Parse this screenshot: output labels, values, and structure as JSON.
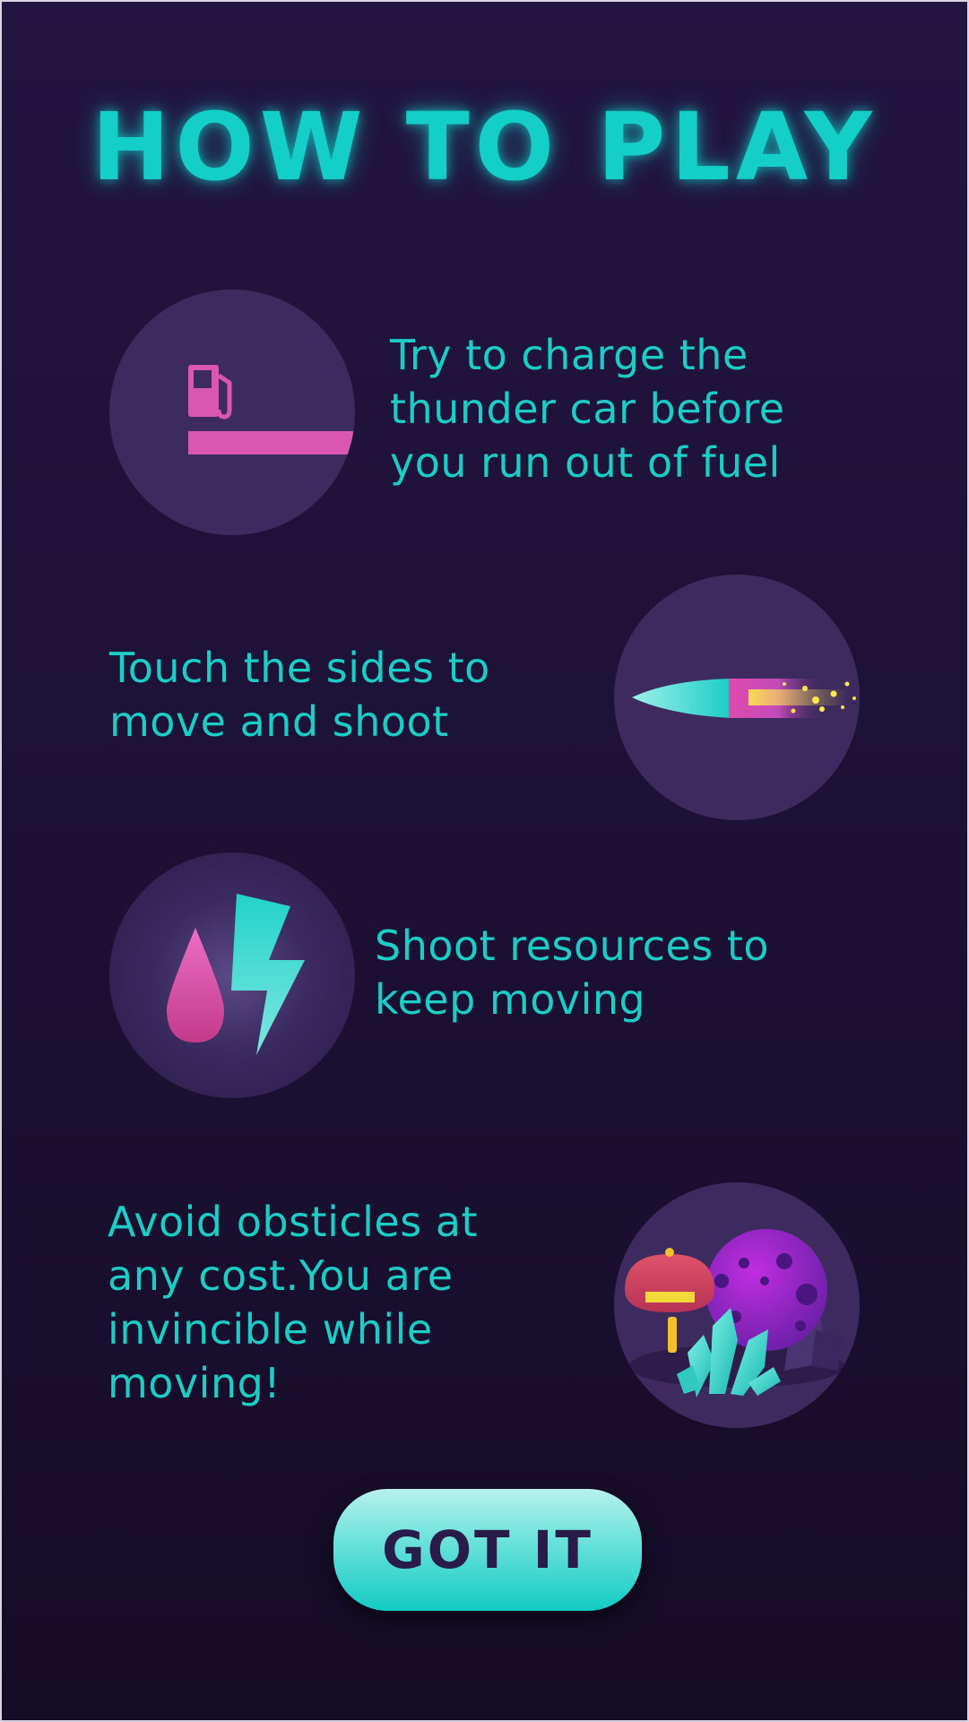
{
  "title": "HOW TO PLAY",
  "steps": [
    {
      "text": "Try to charge the\nthunder car before\nyou run out of fuel",
      "icon": "fuel-pump-icon"
    },
    {
      "text": "Touch the sides to\nmove and shoot",
      "icon": "bullet-icon"
    },
    {
      "text": "Shoot resources to\nkeep moving",
      "icon": "drop-and-lightning-icon"
    },
    {
      "text": "Avoid obsticles at\nany cost.You are\ninvincible while\nmoving!",
      "icon": "obstacles-icon"
    }
  ],
  "button": {
    "label": "GOT IT"
  },
  "colors": {
    "accent": "#14cfc7",
    "pink": "#d957b0",
    "circle": "#3d2a5e",
    "background": "#1c1135"
  }
}
